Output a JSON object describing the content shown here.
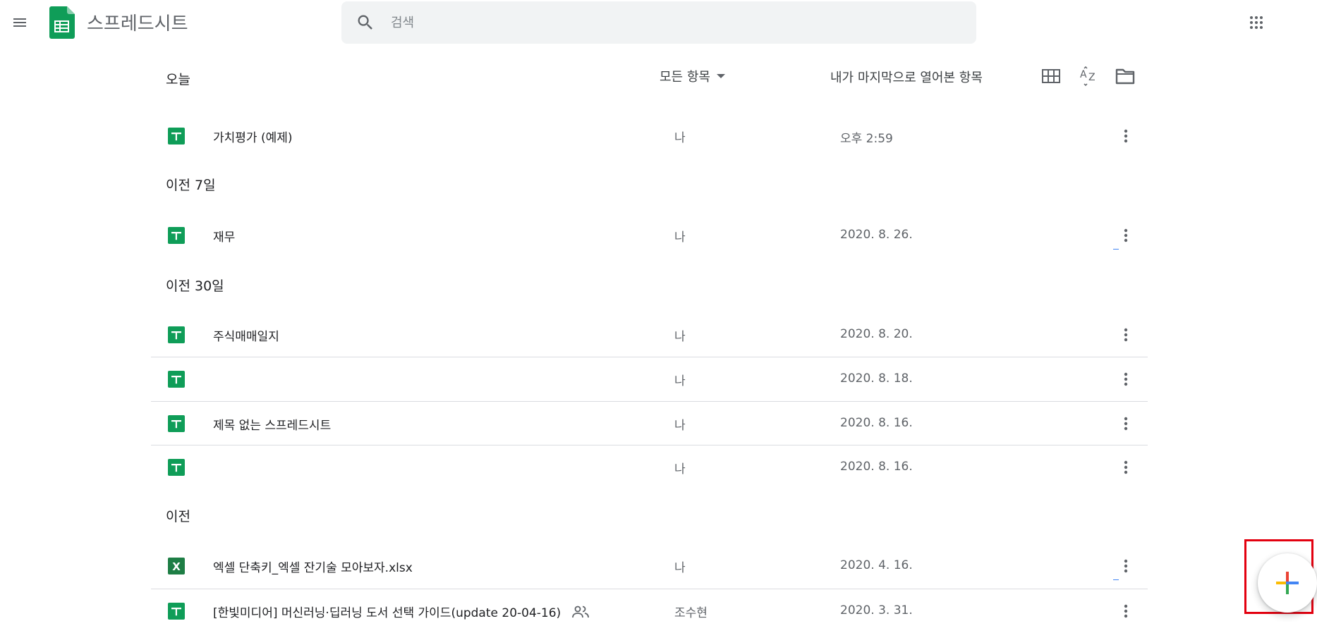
{
  "app": {
    "title": "스프레드시트"
  },
  "search": {
    "placeholder": "검색"
  },
  "toolbar": {
    "owner_filter": "모든 항목",
    "sort_label": "내가 마지막으로 열어본 항목"
  },
  "sections": [
    {
      "label": "오늘"
    },
    {
      "label": "이전 7일"
    },
    {
      "label": "이전 30일"
    },
    {
      "label": "이전"
    }
  ],
  "files": [
    {
      "name": "가치평가 (예제)",
      "owner": "나",
      "date": "오후 2:59",
      "type": "sheets"
    },
    {
      "name": "재무",
      "owner": "나",
      "date": "2020. 8. 26.",
      "type": "sheets"
    },
    {
      "name": "주식매매일지",
      "owner": "나",
      "date": "2020. 8. 20.",
      "type": "sheets"
    },
    {
      "name": "",
      "owner": "나",
      "date": "2020. 8. 18.",
      "type": "sheets"
    },
    {
      "name": "제목 없는 스프레드시트",
      "owner": "나",
      "date": "2020. 8. 16.",
      "type": "sheets"
    },
    {
      "name": "",
      "owner": "나",
      "date": "2020. 8. 16.",
      "type": "sheets"
    },
    {
      "name": "엑셀 단축키_엑셀 잔기술 모아보자.xlsx",
      "owner": "나",
      "date": "2020. 4. 16.",
      "type": "excel"
    },
    {
      "name": "[한빛미디어] 머신러닝·딥러닝 도서 선택 가이드(update 20-04-16)",
      "owner": "조수현",
      "date": "2020. 3. 31.",
      "type": "sheets",
      "shared": true
    }
  ],
  "icons": {
    "menu": "hamburger-menu-icon",
    "logo": "google-sheets-logo",
    "search": "search-icon",
    "apps": "apps-grid-icon",
    "grid_view": "grid-view-icon",
    "sort": "sort-az-icon",
    "folder": "folder-icon",
    "more": "more-vert-icon",
    "shared": "people-icon",
    "new": "plus-icon"
  },
  "colors": {
    "sheets_green": "#0f9d58",
    "excel_green": "#1e7e45",
    "highlight_red": "#e3000f"
  }
}
